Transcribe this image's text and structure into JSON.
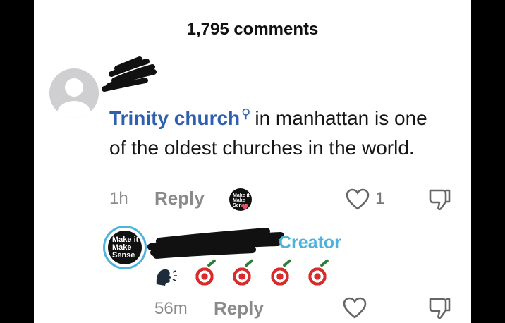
{
  "header": {
    "comment_count": "1,795 comments"
  },
  "comment": {
    "link_text": "Trinity church",
    "text_rest": "in manhattan is one of the oldest churches in the world.",
    "time": "1h",
    "reply_label": "Reply",
    "like_count": "1",
    "badge_text": "Make it Make Sense"
  },
  "reply": {
    "badge_text": "Make it Make Sense",
    "creator_label": "Creator",
    "time": "56m",
    "reply_label": "Reply"
  },
  "icons": [
    "search-icon",
    "heart-icon",
    "dislike-icon",
    "speaking-head-icon",
    "direct-hit-icon"
  ],
  "colors": {
    "link": "#2f5fb0",
    "creator": "#4db3dd",
    "muted": "#8a8a8a"
  }
}
